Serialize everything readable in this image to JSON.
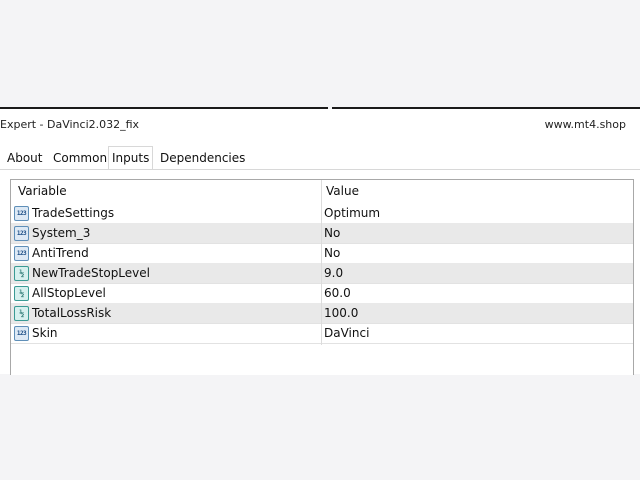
{
  "window": {
    "title": "Expert - DaVinci2.032_fix",
    "site": "www.mt4.shop"
  },
  "tabs": [
    {
      "label": "About",
      "active": false
    },
    {
      "label": "Common",
      "active": false
    },
    {
      "label": "Inputs",
      "active": true
    },
    {
      "label": "Dependencies",
      "active": false
    }
  ],
  "table": {
    "headers": {
      "variable": "Variable",
      "value": "Value"
    },
    "rows": [
      {
        "icon": "123",
        "name": "TradeSettings",
        "value": "Optimum"
      },
      {
        "icon": "123",
        "name": "System_3",
        "value": "No"
      },
      {
        "icon": "123",
        "name": "AntiTrend",
        "value": "No"
      },
      {
        "icon": "½",
        "name": "NewTradeStopLevel",
        "value": "9.0"
      },
      {
        "icon": "½",
        "name": "AllStopLevel",
        "value": "60.0"
      },
      {
        "icon": "½",
        "name": "TotalLossRisk",
        "value": "100.0"
      },
      {
        "icon": "123",
        "name": "Skin",
        "value": "DaVinci"
      }
    ]
  }
}
